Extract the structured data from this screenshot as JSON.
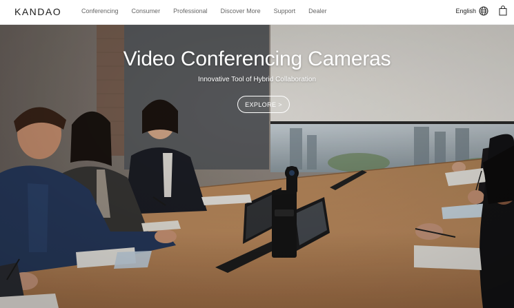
{
  "brand": {
    "logo": "KANDAO"
  },
  "nav": {
    "items": [
      {
        "label": "Conferencing"
      },
      {
        "label": "Consumer"
      },
      {
        "label": "Professional"
      },
      {
        "label": "Discover More"
      },
      {
        "label": "Support"
      },
      {
        "label": "Dealer"
      }
    ],
    "language": "English",
    "globe_icon": "globe-icon",
    "cart_icon": "shopping-bag-icon"
  },
  "hero": {
    "title": "Video Conferencing Cameras",
    "subtitle": "Innovative Tool of Hybrid Collaboration",
    "cta_label": "EXPLORE >"
  }
}
